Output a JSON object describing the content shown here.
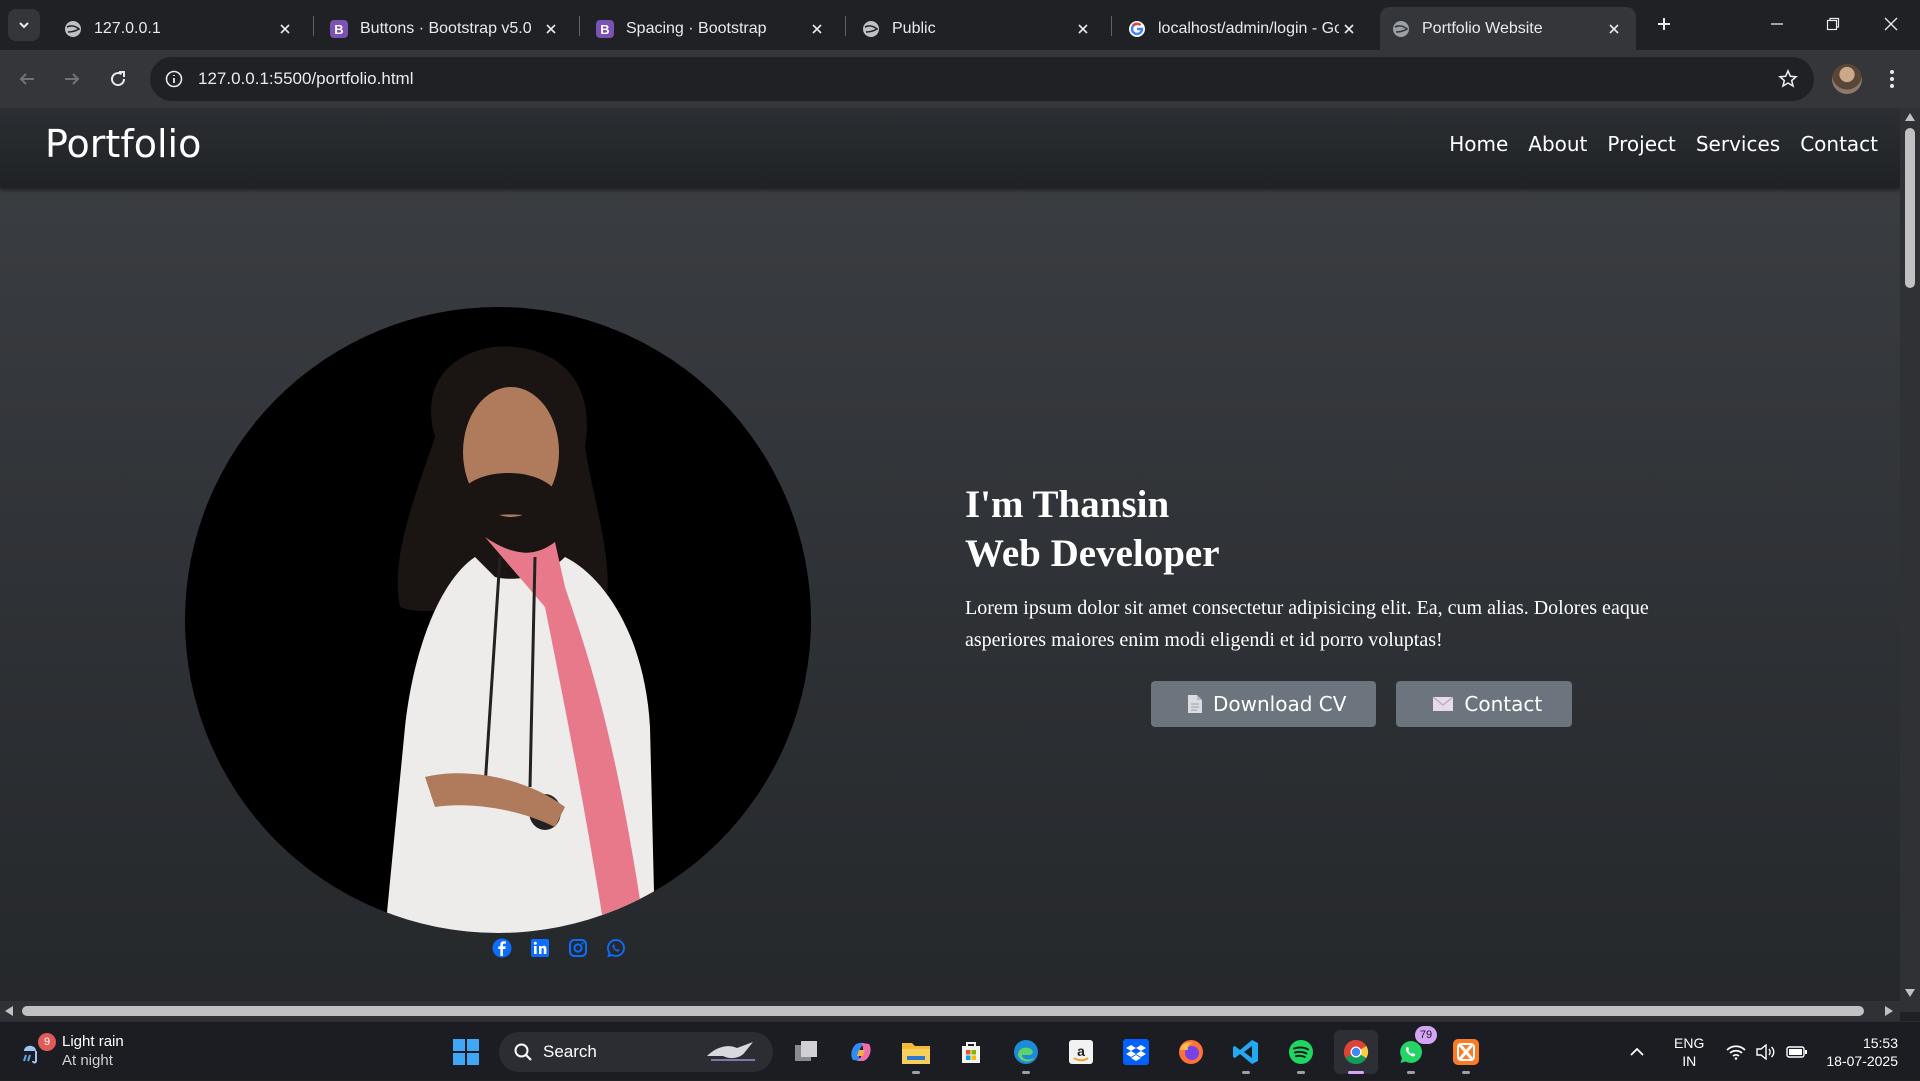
{
  "browser": {
    "tabs": [
      {
        "title": "127.0.0.1",
        "icon": "globe-icon",
        "active": false
      },
      {
        "title": "Buttons · Bootstrap v5.0",
        "icon": "bootstrap-icon",
        "active": false
      },
      {
        "title": "Spacing · Bootstrap",
        "icon": "bootstrap-icon",
        "active": false
      },
      {
        "title": "Public",
        "icon": "globe-icon",
        "active": false
      },
      {
        "title": "localhost/admin/login - Go",
        "icon": "google-icon",
        "active": false
      },
      {
        "title": "Portfolio Website",
        "icon": "globe-icon",
        "active": true
      }
    ],
    "url": "127.0.0.1:5500/portfolio.html"
  },
  "page": {
    "brand": "Portfolio",
    "nav": [
      "Home",
      "About",
      "Project",
      "Services",
      "Contact"
    ],
    "hero": {
      "title_line1": "I'm Thansin",
      "title_line2": "Web Developer",
      "description": "Lorem ipsum dolor sit amet consectetur adipisicing elit. Ea, cum alias. Dolores eaque asperiores maiores enim modi eligendi et id porro voluptas!",
      "download_cv_label": "Download CV",
      "contact_label": "Contact"
    },
    "social": [
      "facebook-icon",
      "linkedin-icon",
      "instagram-icon",
      "whatsapp-icon"
    ],
    "colors": {
      "button": "#6c757d",
      "social": "#0d6efd"
    }
  },
  "taskbar": {
    "weather": {
      "badge": "9",
      "line1": "Light rain",
      "line2": "At night"
    },
    "search_label": "Search",
    "whatsapp_badge": "79",
    "lang": {
      "line1": "ENG",
      "line2": "IN"
    },
    "clock": {
      "time": "15:53",
      "date": "18-07-2025"
    }
  }
}
